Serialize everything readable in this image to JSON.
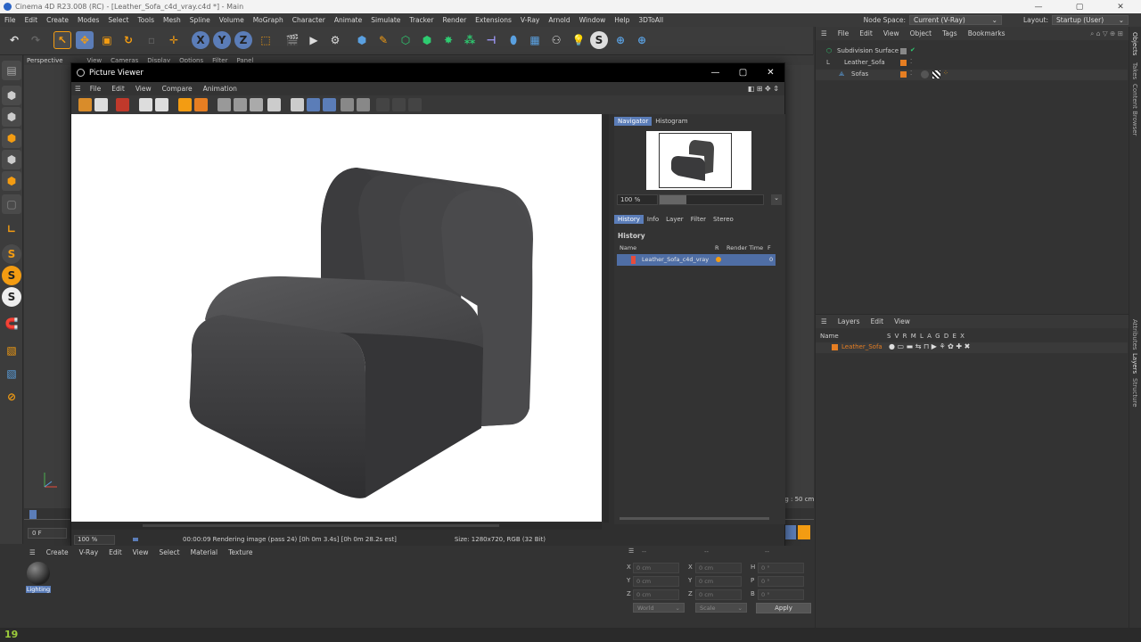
{
  "app": {
    "title": "Cinema 4D R23.008 (RC) - [Leather_Sofa_c4d_vray.c4d *] - Main",
    "window_buttons": [
      "—",
      "▢",
      "✕"
    ]
  },
  "menubar": {
    "items": [
      "File",
      "Edit",
      "Create",
      "Modes",
      "Select",
      "Tools",
      "Mesh",
      "Spline",
      "Volume",
      "MoGraph",
      "Character",
      "Animate",
      "Simulate",
      "Tracker",
      "Render",
      "Extensions",
      "V-Ray",
      "Arnold",
      "Window",
      "Help",
      "3DToAll"
    ],
    "node_space_label": "Node Space:",
    "node_space_value": "Current (V-Ray)",
    "layout_label": "Layout:",
    "layout_value": "Startup (User)"
  },
  "toolbar": {
    "axis_x": "X",
    "axis_y": "Y",
    "axis_z": "Z"
  },
  "lefttb": {
    "s_label": "S"
  },
  "viewport": {
    "menu": [
      "View",
      "Cameras",
      "Display",
      "Options",
      "Filter",
      "Panel"
    ],
    "camera": "Perspective",
    "grid_spacing": "Grid Spacing : 50 cm",
    "frame": "0 F"
  },
  "picture_viewer": {
    "title": "Picture Viewer",
    "window_buttons": [
      "—",
      "▢",
      "✕"
    ],
    "menu": [
      "File",
      "Edit",
      "View",
      "Compare",
      "Animation"
    ],
    "tabs_top": [
      "Navigator",
      "Histogram"
    ],
    "zoom": "100 %",
    "tabs_mid": [
      "History",
      "Info",
      "Layer",
      "Filter",
      "Stereo"
    ],
    "history_heading": "History",
    "history_columns": {
      "name": "Name",
      "r": "R",
      "render_time": "Render Time",
      "f": "F"
    },
    "history_row": {
      "name": "Leather_Sofa_c4d_vray",
      "f": "0"
    },
    "status_zoom": "100 %",
    "status_text": "00:00:09 Rendering image (pass 24) [0h  0m  3.4s] [0h  0m 28.2s est]",
    "status_size": "Size: 1280x720, RGB (32 Bit)"
  },
  "objects": {
    "menu": [
      "File",
      "Edit",
      "View",
      "Object",
      "Tags",
      "Bookmarks"
    ],
    "items": [
      "Subdivision Surface",
      "Leather_Sofa",
      "Sofas"
    ]
  },
  "layers": {
    "menu": [
      "Layers",
      "Edit",
      "View"
    ],
    "col_name": "Name",
    "col_flags": "S V R M L A G D E X",
    "row": "Leather_Sofa"
  },
  "vtabs": [
    "Objects",
    "Takes",
    "Content Browser",
    "Attributes",
    "Layers",
    "Structure"
  ],
  "material": {
    "menu": [
      "Create",
      "V-Ray",
      "Edit",
      "View",
      "Select",
      "Material",
      "Texture"
    ],
    "item": "Lighting"
  },
  "coords": {
    "header": "--",
    "x": "X",
    "y": "Y",
    "z": "Z",
    "h": "H",
    "p": "P",
    "b": "B",
    "value_cm": "0 cm",
    "value_deg": "0 °",
    "world": "World",
    "scale": "Scale",
    "apply": "Apply"
  },
  "bottom": {
    "logo_text": "19"
  },
  "colors": {
    "accent_blue": "#5b7db8",
    "orange": "#f39c12",
    "render_bg": "#ffffff",
    "sofa": "#3e3e40"
  }
}
